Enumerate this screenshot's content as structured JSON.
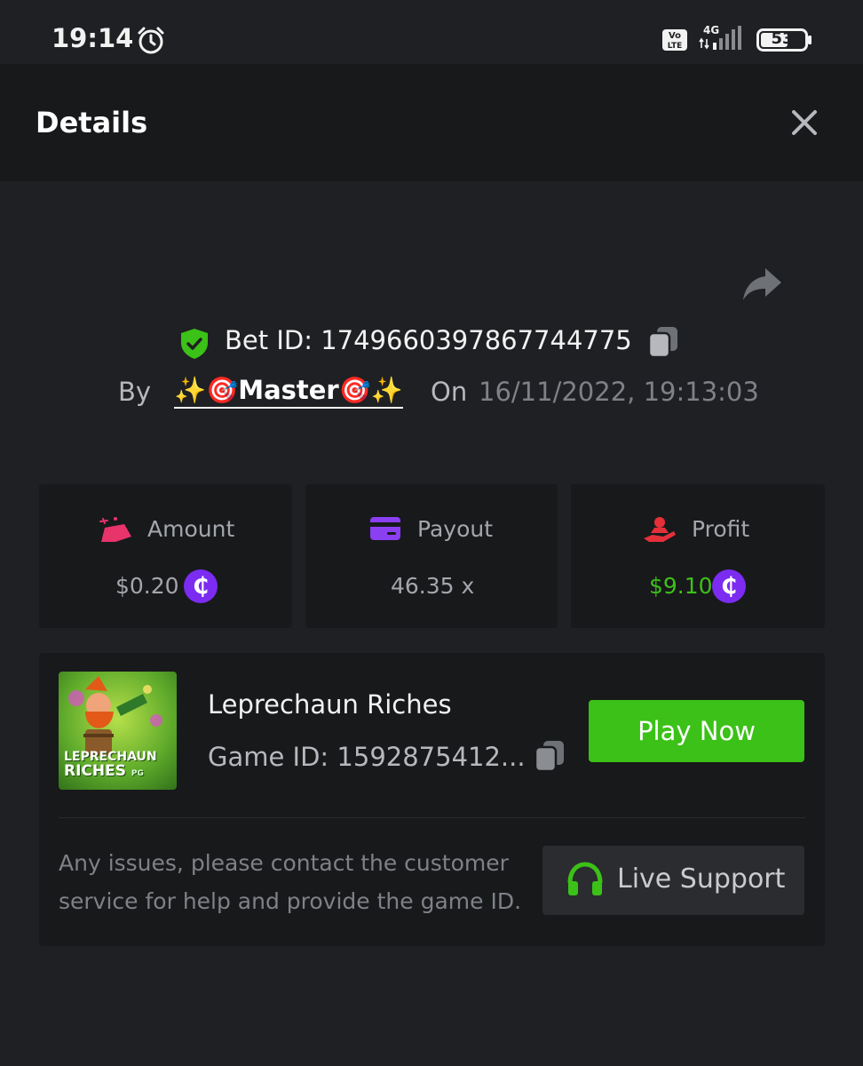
{
  "status_bar": {
    "time": "19:14",
    "network": "4G",
    "volte": "Vo LTE",
    "battery": "53"
  },
  "header": {
    "title": "Details"
  },
  "bet": {
    "bet_id_label": "Bet ID: 1749660397867744775",
    "by_label": "By",
    "username": "✨🎯Master🎯✨",
    "on_label": "On",
    "datetime": "16/11/2022, 19:13:03"
  },
  "stats": {
    "amount": {
      "label": "Amount",
      "value": "$0.20"
    },
    "payout": {
      "label": "Payout",
      "value": "46.35 x"
    },
    "profit": {
      "label": "Profit",
      "value": "$9.10"
    },
    "coin_symbol": "₵"
  },
  "game": {
    "name": "Leprechaun Riches",
    "game_id": "Game ID: 1592875412...",
    "thumb_text_line1": "LEPRECHAUN",
    "thumb_text_line2": "RICHES",
    "thumb_brand": "PG",
    "play_label": "Play Now",
    "help_text": "Any issues, please contact the customer service for help and provide the game ID.",
    "support_label": "Live Support"
  },
  "colors": {
    "accent_green": "#3bc117",
    "coin_purple": "#7b2cf0",
    "profit_green": "#3bc117",
    "amount_pink": "#e8336b",
    "payout_purple": "#8a3ff0",
    "profit_red": "#e5303a"
  }
}
